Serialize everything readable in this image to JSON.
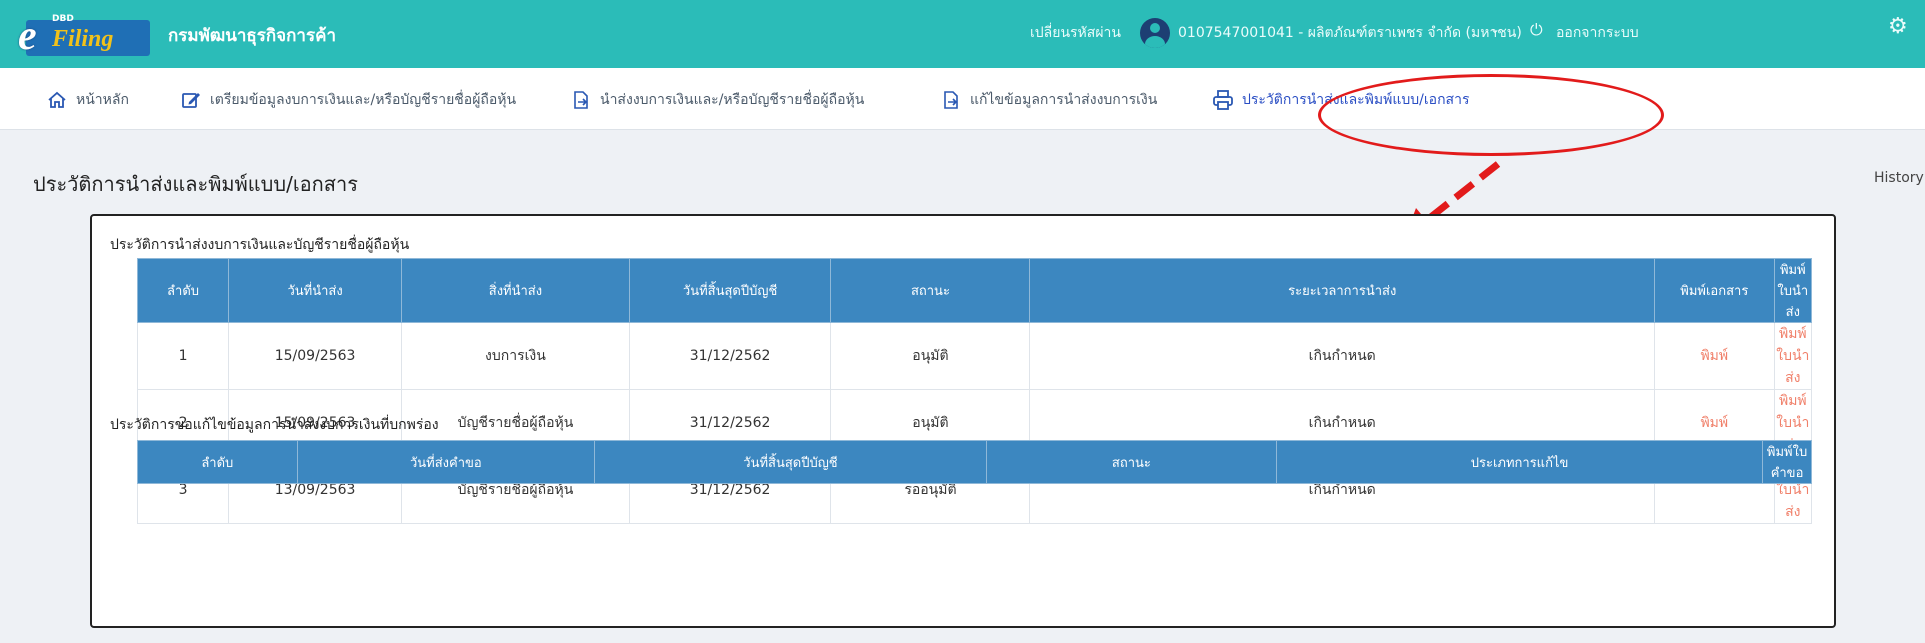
{
  "colors": {
    "topbar": "#2bbcb8",
    "table_header": "#3c87c0",
    "print_link": "#f0806a",
    "annotation": "#e21b1b"
  },
  "header": {
    "logo_small": "DBD",
    "logo_e": "e",
    "logo_filing": "Filing",
    "brand": "กรมพัฒนาธุรกิจการค้า",
    "change_password": "เปลี่ยนรหัสผ่าน",
    "user": "0107547001041 - ผลิตภัณฑ์ตราเพชร จำกัด (มหาชน)",
    "logout": "ออกจากระบบ"
  },
  "nav": {
    "home": "หน้าหลัก",
    "prepare": "เตรียมข้อมูลงบการเงินและ/หรือบัญชีรายชื่อผู้ถือหุ้น",
    "submit": "นำส่งงบการเงินและ/หรือบัญชีรายชื่อผู้ถือหุ้น",
    "edit": "แก้ไขข้อมูลการนำส่งงบการเงิน",
    "history": "ประวัติการนำส่งและพิมพ์แบบ/เอกสาร"
  },
  "page": {
    "title": "ประวัติการนำส่งและพิมพ์แบบ/เอกสาร",
    "breadcrumb": "History"
  },
  "submission_history": {
    "title": "ประวัติการนำส่งงบการเงินและบัญชีรายชื่อผู้ถือหุ้น",
    "headers": [
      "ลำดับ",
      "วันที่นำส่ง",
      "สิ่งที่นำส่ง",
      "วันที่สิ้นสุดปีบัญชี",
      "สถานะ",
      "ระยะเวลาการนำส่ง",
      "พิมพ์เอกสาร",
      "พิมพ์ใบนำส่ง"
    ],
    "rows": [
      {
        "no": "1",
        "date": "15/09/2563",
        "item": "งบการเงิน",
        "fiscal_end": "31/12/2562",
        "status": "อนุมัติ",
        "period": "เกินกำหนด",
        "print_doc": "พิมพ์",
        "print_slip": "พิมพ์ใบนำส่ง"
      },
      {
        "no": "2",
        "date": "15/09/2563",
        "item": "บัญชีรายชื่อผู้ถือหุ้น",
        "fiscal_end": "31/12/2562",
        "status": "อนุมัติ",
        "period": "เกินกำหนด",
        "print_doc": "พิมพ์",
        "print_slip": "พิมพ์ใบนำส่ง"
      },
      {
        "no": "3",
        "date": "13/09/2563",
        "item": "บัญชีรายชื่อผู้ถือหุ้น",
        "fiscal_end": "31/12/2562",
        "status": "รออนุมัติ",
        "period": "เกินกำหนด",
        "print_doc": "",
        "print_slip": "พิมพ์ใบนำส่ง"
      }
    ]
  },
  "correction_history": {
    "title": "ประวัติการขอแก้ไขข้อมูลการนำส่งงบการเงินที่บกพร่อง",
    "headers": [
      "ลำดับ",
      "วันที่ส่งคำขอ",
      "วันที่สิ้นสุดปีบัญชี",
      "สถานะ",
      "ประเภทการแก้ไข",
      "พิมพ์ใบคำขอ"
    ]
  }
}
